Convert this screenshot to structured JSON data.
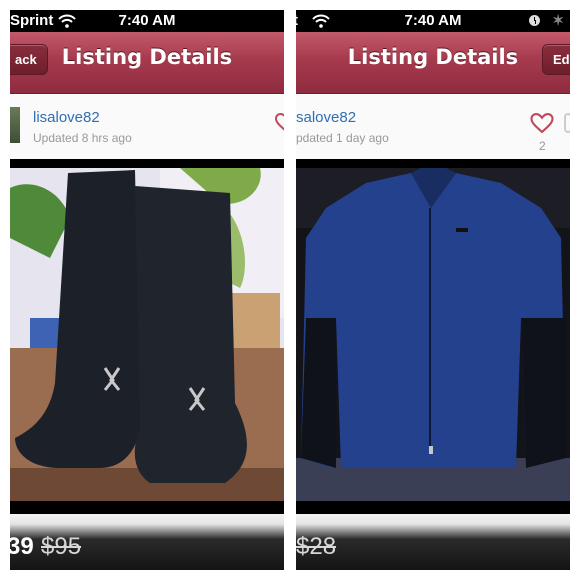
{
  "left": {
    "status": {
      "carrier": "Sprint",
      "time": "7:40 AM"
    },
    "nav": {
      "back_label": "ack",
      "title": "Listing Details"
    },
    "user": {
      "username": "lisalove82",
      "updated": "Updated 8 hrs ago"
    },
    "listing": {
      "price": "39",
      "original_price": "$95"
    }
  },
  "right": {
    "status": {
      "carrier": "t",
      "time": "7:40 AM"
    },
    "nav": {
      "title": "Listing Details",
      "edit_label": "Ed"
    },
    "user": {
      "username": "salove82",
      "updated": "pdated 1 day ago",
      "like_count": "2"
    },
    "listing": {
      "price": "$28"
    }
  },
  "colors": {
    "nav_bar": "#a63a4d",
    "username_link": "#2f6fb2",
    "heart": "#c0485a",
    "muted_text": "#999999"
  },
  "icons": [
    "wifi-icon",
    "heart-icon",
    "clock-icon",
    "bluetooth-icon"
  ]
}
